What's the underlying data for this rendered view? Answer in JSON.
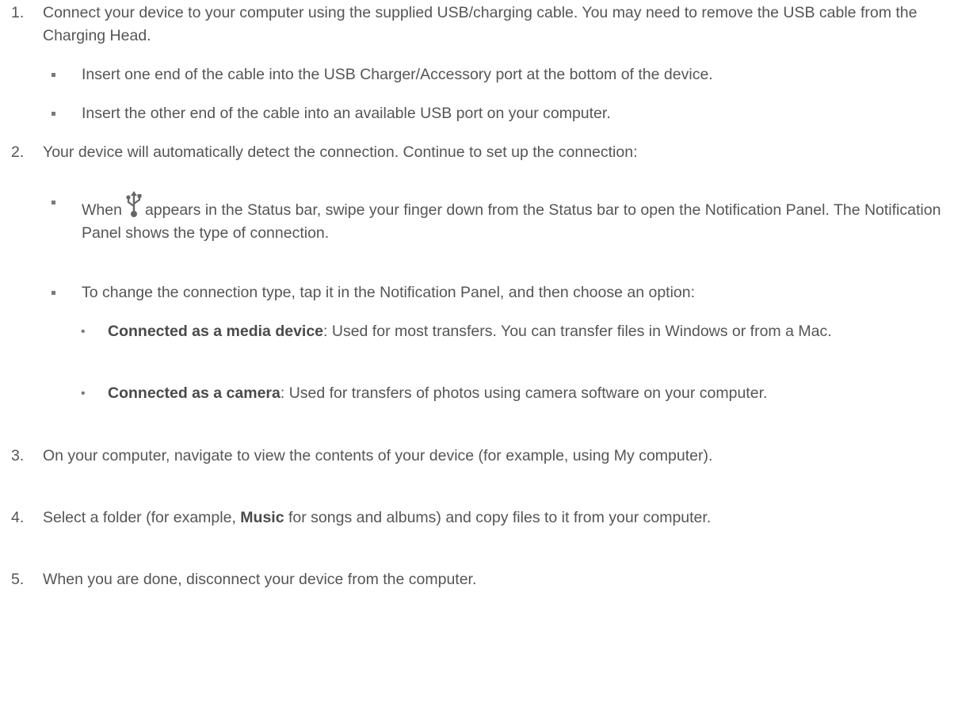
{
  "steps": [
    {
      "number": "1.",
      "text": "Connect your device to your computer using the supplied USB/charging cable. You may need to remove the USB cable from the Charging Head.",
      "bullets": [
        "Insert one end of the cable into the USB Charger/Accessory port at the bottom of the device.",
        "Insert the other end of the cable into an available USB port on your computer."
      ]
    },
    {
      "number": "2.",
      "text": "Your device will automatically detect the connection. Continue to set up the connection:",
      "bullets": [
        {
          "before_icon": "When",
          "icon": "usb-icon",
          "after_icon": "appears in the Status bar, swipe your finger down from the Status bar to open the Notification Panel. The Notification Panel shows the type of connection."
        },
        {
          "text": "To change the connection type, tap it in the Notification Panel, and then choose an option:",
          "options": [
            {
              "label": "Connected as a media device",
              "desc": ": Used for most transfers. You can transfer files in Windows or from a Mac."
            },
            {
              "label": "Connected as a camera",
              "desc": ": Used for transfers of photos using camera software on your computer."
            }
          ]
        }
      ]
    },
    {
      "number": "3.",
      "text": "On your computer, navigate to view the contents of your device (for example, using My computer)."
    },
    {
      "number": "4.",
      "before": "Select a folder (for example, ",
      "bold": "Music",
      "after": " for songs and albums) and copy files to it from your computer."
    },
    {
      "number": "5.",
      "text": "When you are done, disconnect your device from the computer."
    }
  ]
}
